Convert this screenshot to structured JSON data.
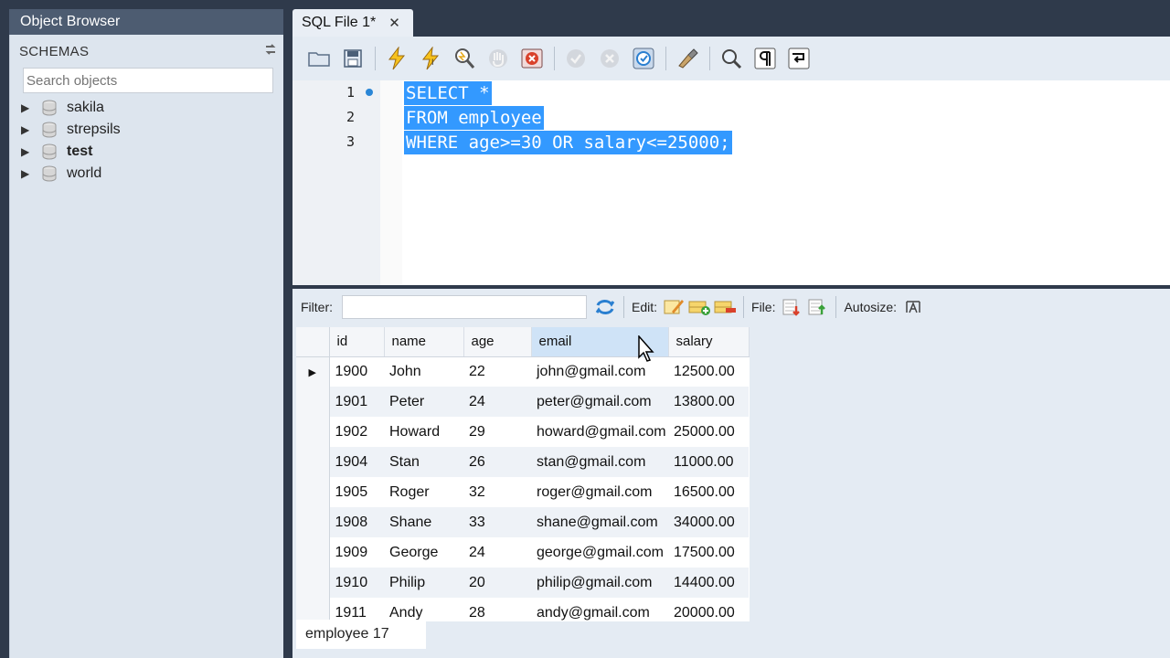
{
  "object_browser": {
    "title": "Object Browser",
    "schemas_label": "SCHEMAS",
    "search_placeholder": "Search objects",
    "schemas": [
      {
        "name": "sakila",
        "bold": false
      },
      {
        "name": "strepsils",
        "bold": false
      },
      {
        "name": "test",
        "bold": true
      },
      {
        "name": "world",
        "bold": false
      }
    ]
  },
  "editor": {
    "tab_title": "SQL File 1*",
    "toolbar_icons": [
      "open-folder-icon",
      "save-icon",
      "execute-icon",
      "execute-current-icon",
      "explain-icon",
      "stop-icon",
      "toggle-error-icon",
      "commit-icon",
      "rollback-icon",
      "autocommit-icon",
      "beautify-icon",
      "find-icon",
      "invisible-chars-icon",
      "word-wrap-icon"
    ],
    "lines": [
      {
        "number": "1",
        "text": "SELECT *"
      },
      {
        "number": "2",
        "text": "FROM employee"
      },
      {
        "number": "3",
        "text": "WHERE age>=30 OR salary<=25000;"
      }
    ]
  },
  "results": {
    "filter_label": "Filter:",
    "edit_label": "Edit:",
    "file_label": "File:",
    "autosize_label": "Autosize:",
    "columns": [
      "id",
      "name",
      "age",
      "email",
      "salary"
    ],
    "rows": [
      [
        "1900",
        "John",
        "22",
        "john@gmail.com",
        "12500.00"
      ],
      [
        "1901",
        "Peter",
        "24",
        "peter@gmail.com",
        "13800.00"
      ],
      [
        "1902",
        "Howard",
        "29",
        "howard@gmail.com",
        "25000.00"
      ],
      [
        "1904",
        "Stan",
        "26",
        "stan@gmail.com",
        "11000.00"
      ],
      [
        "1905",
        "Roger",
        "32",
        "roger@gmail.com",
        "16500.00"
      ],
      [
        "1908",
        "Shane",
        "33",
        "shane@gmail.com",
        "34000.00"
      ],
      [
        "1909",
        "George",
        "24",
        "george@gmail.com",
        "17500.00"
      ],
      [
        "1910",
        "Philip",
        "20",
        "philip@gmail.com",
        "14400.00"
      ],
      [
        "1911",
        "Andy",
        "28",
        "andy@gmail.com",
        "20000.00"
      ]
    ],
    "result_tab": "employee 17"
  },
  "colors": {
    "selection": "#3399ff",
    "window_bg": "#2f3a4b",
    "panel_bg": "#e4ebf3"
  }
}
